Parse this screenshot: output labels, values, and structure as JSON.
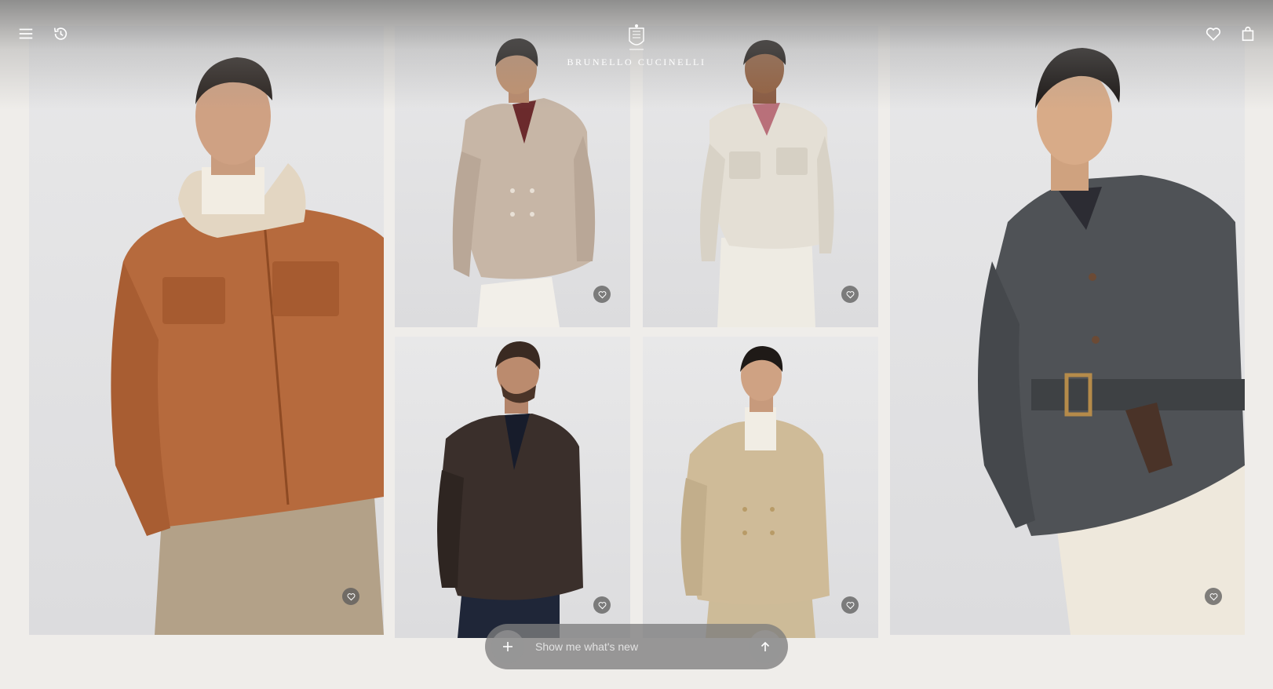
{
  "brand": {
    "name": "BRUNELLO CUCINELLI"
  },
  "header": {
    "menu_icon": "menu-icon",
    "history_icon": "history-icon",
    "wishlist_icon": "heart-icon",
    "bag_icon": "shopping-bag-icon"
  },
  "products": [
    {
      "id": "shearling-jacket",
      "description": "Model in orange suede shearling jacket with cream collar",
      "colors": {
        "garment": "#b8693a",
        "collar": "#e7dccb"
      }
    },
    {
      "id": "double-breasted-blazer-taupe",
      "description": "Model in taupe double-breasted blazer",
      "colors": {
        "garment": "#c8b8a8"
      }
    },
    {
      "id": "field-jacket-white",
      "description": "Model in off-white field jacket",
      "colors": {
        "garment": "#e3ddd2"
      }
    },
    {
      "id": "leather-blazer",
      "description": "Model in dark brown leather blazer",
      "colors": {
        "garment": "#3b2f2a"
      }
    },
    {
      "id": "double-breasted-blazer-beige",
      "description": "Model in beige double-breasted blazer with turtleneck",
      "colors": {
        "garment": "#cdb996"
      }
    },
    {
      "id": "belted-wool-coat",
      "description": "Model in charcoal grey belted wool jacket",
      "colors": {
        "garment": "#4e5154"
      }
    }
  ],
  "favorite_icon": "heart-icon",
  "prompt": {
    "placeholder": "Show me what's new",
    "add_icon": "plus-icon",
    "send_icon": "arrow-up-icon"
  }
}
